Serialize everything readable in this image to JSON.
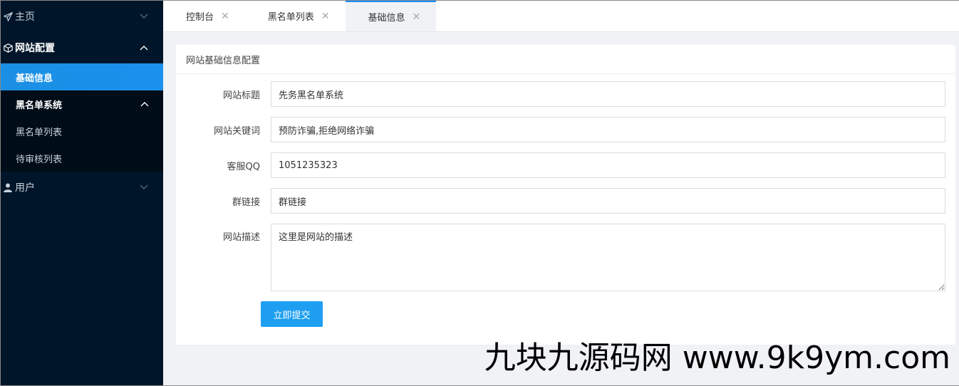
{
  "sidebar": {
    "home": {
      "label": "主页"
    },
    "site_config": {
      "label": "网站配置",
      "items": [
        {
          "label": "基础信息"
        }
      ]
    },
    "blacklist": {
      "label": "黑名单系统",
      "items": [
        {
          "label": "黑名单列表"
        },
        {
          "label": "待审核列表"
        }
      ]
    },
    "user": {
      "label": "用户"
    }
  },
  "tabs": [
    {
      "label": "控制台"
    },
    {
      "label": "黑名单列表"
    },
    {
      "label": "基础信息"
    }
  ],
  "card": {
    "title": "网站基础信息配置",
    "fields": {
      "title": {
        "label": "网站标题",
        "value": "先务黑名单系统"
      },
      "keywords": {
        "label": "网站关键词",
        "value": "预防诈骗,拒绝网络诈骗"
      },
      "qq": {
        "label": "客服QQ",
        "value": "1051235323"
      },
      "group": {
        "label": "群链接",
        "value": "群链接"
      },
      "description": {
        "label": "网站描述",
        "value": "这里是网站的描述"
      }
    },
    "submit_label": "立即提交"
  },
  "watermark": "九块九源码网 www.9k9ym.com",
  "colors": {
    "sidebar_bg": "#001529",
    "active": "#1890ff",
    "button": "#1e9ff2"
  }
}
